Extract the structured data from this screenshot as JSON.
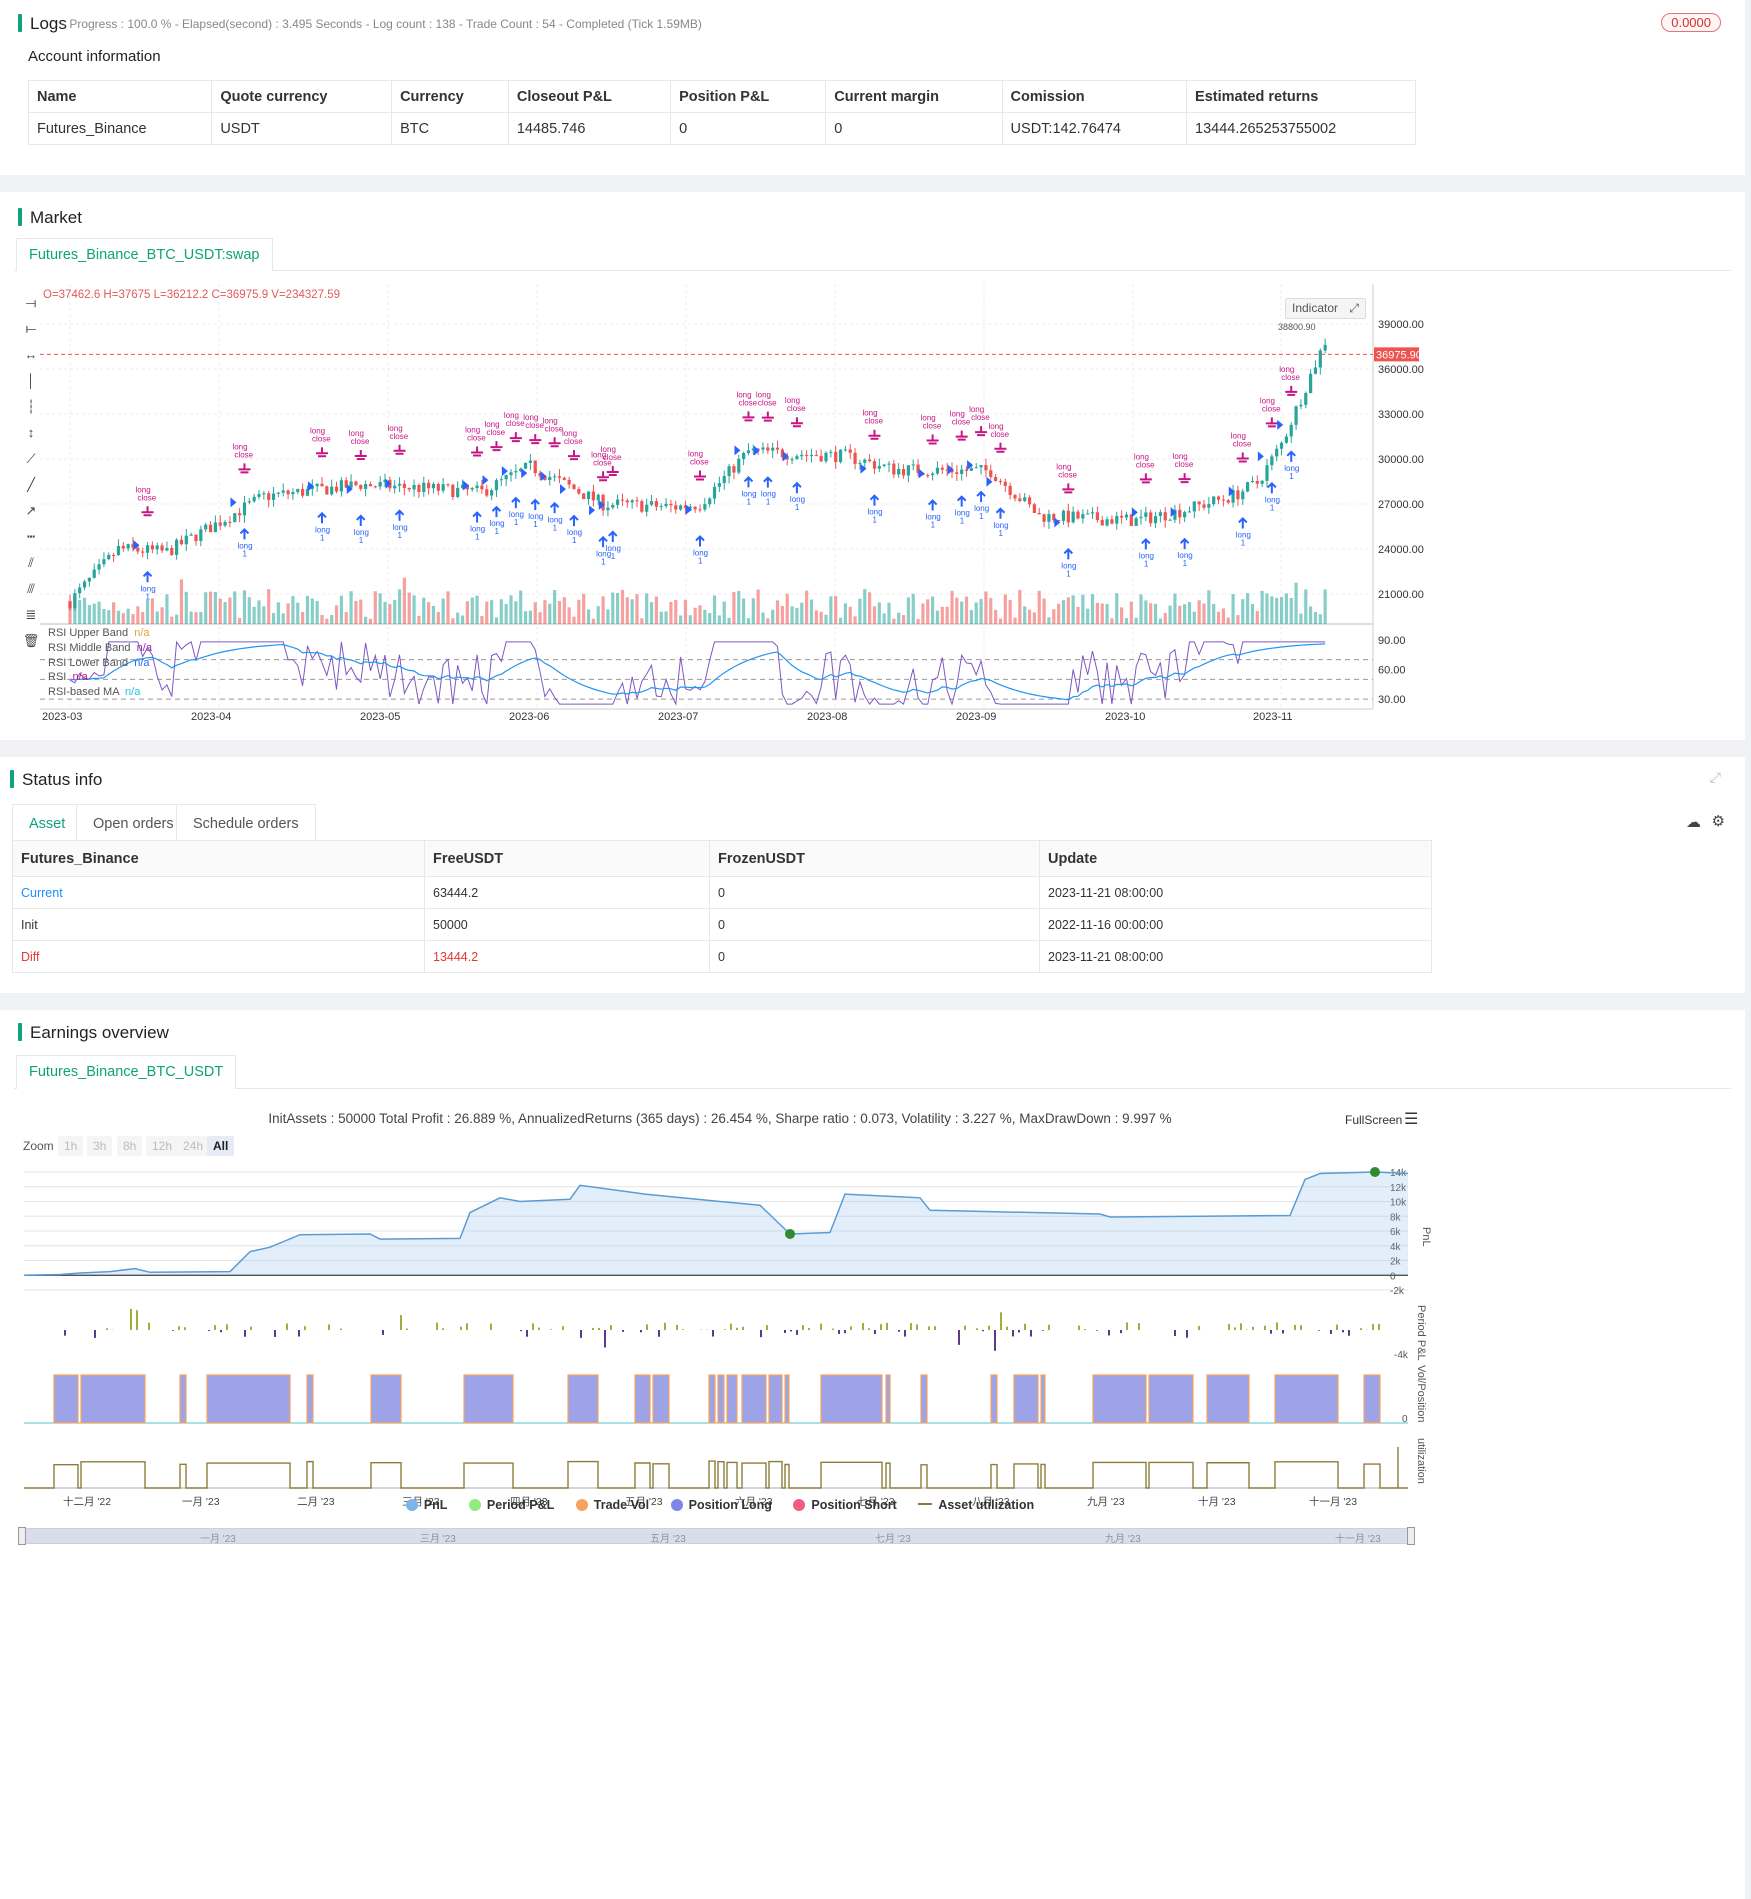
{
  "logs": {
    "title": "Logs",
    "status": "- Progress : 100.0 % - Elapsed(second) : 3.495  Seconds - Log count : 138 - Trade Count : 54 - Completed (Tick 1.59MB)",
    "badge": "0.0000"
  },
  "account": {
    "title": "Account information",
    "headers": [
      "Name",
      "Quote currency",
      "Currency",
      "Closeout P&L",
      "Position P&L",
      "Current margin",
      "Comission",
      "Estimated returns"
    ],
    "row": [
      "Futures_Binance",
      "USDT",
      "BTC",
      "14485.746",
      "0",
      "0",
      "USDT:142.76474",
      "13444.265253755002"
    ]
  },
  "market": {
    "title": "Market",
    "tab": "Futures_Binance_BTC_USDT:swap",
    "ohlc": "O=37462.6 H=37675 L=36212.2 C=36975.9 V=234327.59",
    "indicator_btn": "Indicator",
    "price_tag": "36975.90",
    "price_levels": [
      "39000.00",
      "36000.00",
      "33000.00",
      "30000.00",
      "27000.00",
      "24000.00",
      "21000.00"
    ],
    "rsi_levels": [
      "90.00",
      "60.00",
      "30.00"
    ],
    "x_ticks": [
      "2023-03",
      "2023-04",
      "2023-05",
      "2023-06",
      "2023-07",
      "2023-08",
      "2023-09",
      "2023-10",
      "2023-11"
    ],
    "rsi_legend": [
      {
        "label": "RSI Upper Band",
        "value": "n/a",
        "color": "#e6a23c"
      },
      {
        "label": "RSI Middle Band",
        "value": "n/a",
        "color": "#9c27b0"
      },
      {
        "label": "RSI Lower Band",
        "value": "n/a",
        "color": "#2962ff"
      },
      {
        "label": "RSI",
        "value": "n/a",
        "color": "#7e57c2"
      },
      {
        "label": "RSI-based MA",
        "value": "n/a",
        "color": "#26c6da"
      }
    ],
    "marker_labels": {
      "long": "long",
      "close": "close",
      "one": "1"
    },
    "high_label": "38800.90",
    "colors": {
      "up": "#26a69a",
      "down": "#ef5350",
      "rsi": "#7e57c2",
      "rsi_ma": "#2196f3",
      "signal": "#c71585",
      "long": "#2962ff"
    }
  },
  "status": {
    "title": "Status info",
    "tabs": [
      "Asset",
      "Open orders",
      "Schedule orders"
    ],
    "headers": [
      "Futures_Binance",
      "FreeUSDT",
      "FrozenUSDT",
      "Update"
    ],
    "rows": [
      [
        "Current",
        "63444.2",
        "0",
        "2023-11-21 08:00:00"
      ],
      [
        "Init",
        "50000",
        "0",
        "2022-11-16 00:00:00"
      ],
      [
        "Diff",
        "13444.2",
        "0",
        "2023-11-21 08:00:00"
      ]
    ]
  },
  "earnings": {
    "title": "Earnings overview",
    "tab": "Futures_Binance_BTC_USDT",
    "summary": "InitAssets : 50000 Total Profit : 26.889 %, AnnualizedReturns (365 days) : 26.454 %, Sharpe ratio : 0.073, Volatility : 3.227 %, MaxDrawDown : 9.997 %",
    "fullscreen": "FullScreen",
    "zoom_label": "Zoom",
    "zoom_options": [
      "1h",
      "3h",
      "8h",
      "12h",
      "24h",
      "All"
    ],
    "pnl_levels": [
      "14k",
      "12k",
      "10k",
      "8k",
      "6k",
      "4k",
      "2k",
      "0",
      "-2k"
    ],
    "period_level": "-4k",
    "zero_label": "0",
    "axis_titles": [
      "PnL",
      "Period P&L",
      "Vol/Position",
      "utilization"
    ],
    "months": [
      "十二月 '22",
      "一月 '23",
      "二月 '23",
      "三月 '23",
      "四月 '23",
      "五月 '23",
      "六月 '23",
      "七月 '23",
      "八月 '23",
      "九月 '23",
      "十月 '23",
      "十一月 '23"
    ],
    "navigator_months": [
      "一月 '23",
      "三月 '23",
      "五月 '23",
      "七月 '23",
      "九月 '23",
      "十一月 '23"
    ],
    "legend": [
      {
        "label": "PnL",
        "color": "#7cb5ec"
      },
      {
        "label": "Period P&L",
        "color": "#90ed7d"
      },
      {
        "label": "Trade Vol",
        "color": "#f7a35c"
      },
      {
        "label": "Position Long",
        "color": "#8085e9"
      },
      {
        "label": "Position Short",
        "color": "#f15c80"
      },
      {
        "label": "Asset utilization",
        "color": "#8d7d3a"
      }
    ]
  }
}
